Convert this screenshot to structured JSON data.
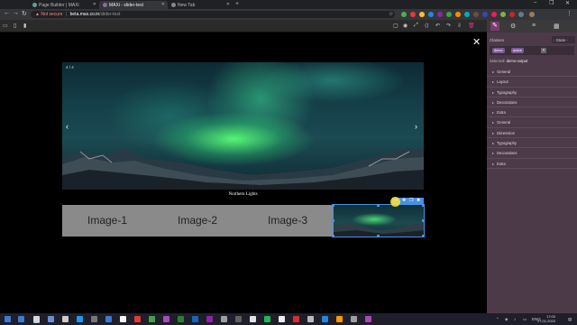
{
  "browser": {
    "tabs": [
      {
        "label": "Page Builder | MAXi",
        "favicon_color": "#5f9ea0",
        "active": false
      },
      {
        "label": "MAXi - slider-test",
        "favicon_color": "#8a6ba0",
        "active": true
      },
      {
        "label": "New Tab",
        "favicon_color": "#888888",
        "active": false
      }
    ],
    "new_tab_glyph": "+",
    "address": {
      "warning": "Not secure",
      "host": "beta.max.co.in",
      "path": "/slider-test"
    }
  },
  "editor_toolbar": {
    "left_icons": [
      "desktop-icon",
      "tablet-icon",
      "mobile-icon"
    ],
    "right_icons": [
      "square-icon",
      "eye-icon",
      "fullscreen-icon",
      "code-icon",
      "undo-icon",
      "redo-icon",
      "import-icon",
      "trash-icon"
    ]
  },
  "right_panel": {
    "tab_icons": [
      "brush-icon",
      "gear-icon",
      "layers-icon",
      "blocks-icon"
    ],
    "classes_label": "Classes",
    "state_label": "- State -",
    "tags": [
      "demo",
      "active"
    ],
    "add_glyph": "+",
    "selected_label": "Selected:",
    "selected_value": "demo-output",
    "sections": [
      "General",
      "Layout",
      "Typography",
      "Decorations",
      "Extra",
      "General",
      "Dimension",
      "Typography",
      "Decorations",
      "Extra"
    ]
  },
  "slider": {
    "counter": "4 / 4",
    "caption": "Northern Lights",
    "prev_glyph": "‹",
    "next_glyph": "›",
    "thumbnails": [
      "Image-1",
      "Image-2",
      "Image-3"
    ]
  },
  "close_glyph": "✕",
  "taskbar": {
    "time": "17:00",
    "date": "27.01.2020",
    "lang": "ENG"
  }
}
